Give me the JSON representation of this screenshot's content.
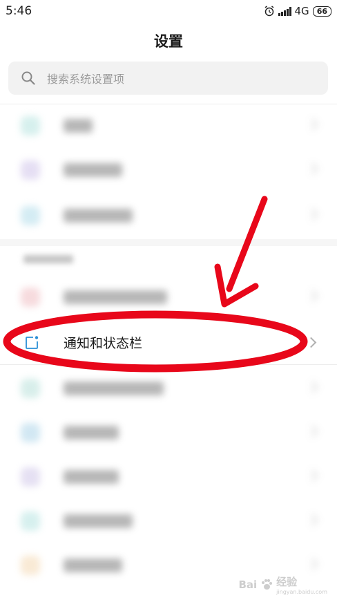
{
  "status_bar": {
    "time": "5:46",
    "network": "4G",
    "battery": "66"
  },
  "header": {
    "title": "设置"
  },
  "search": {
    "placeholder": "搜索系统设置项"
  },
  "highlighted_item": {
    "label": "通知和状态栏"
  },
  "watermark": {
    "brand": "Bai",
    "brand_suffix": "经验",
    "url": "jingyan.baidu.com"
  },
  "colors": {
    "accent": "#2a8fd6",
    "annotation_red": "#e8071a"
  },
  "icons": [
    "search-icon",
    "alarm-icon",
    "signal-icon",
    "notification-status-bar-icon",
    "chevron-right-icon",
    "baidu-paw-icon"
  ]
}
